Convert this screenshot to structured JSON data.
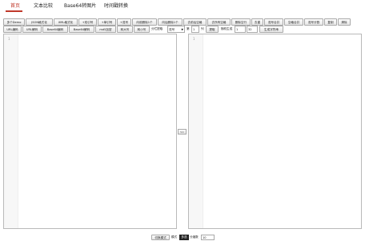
{
  "nav": {
    "tabs": [
      {
        "label": "首页",
        "active": true
      },
      {
        "label": "文本比较",
        "active": false
      },
      {
        "label": "Base64转图片",
        "active": false
      },
      {
        "label": "时间戳转换",
        "active": false
      }
    ]
  },
  "toolbar_row1": [
    "多个Demo",
    "JSON格式化",
    "XML格式化",
    "+双引号",
    "+单引号",
    "+逗号",
    "向前删除1个",
    "向后删除1个",
    "去前后空格",
    "去所有空格",
    "删除空行",
    "去重",
    "逗号合并",
    "空格合并",
    "逗号分割",
    "复制",
    "清除"
  ],
  "toolbar_row2": {
    "buttons": [
      "URL编码",
      "URL解码",
      "Base64编码",
      "Base64解码",
      "md5加密",
      "转大写",
      "转小写"
    ],
    "split_label": "分栏提取",
    "split_select": "逗号",
    "column_label": "第",
    "column_value": "1",
    "column_unit": "列",
    "extract_button": "提取",
    "random_label": "随机生成",
    "random_value_1": "1",
    "random_value_2": "32",
    "generate_button": "生成字符串"
  },
  "editors": {
    "left_line": "1",
    "right_line": "1"
  },
  "swap_label": "<=",
  "footer": {
    "mode_button": "切换模式",
    "mode_label": "模式",
    "mode_value": "多选",
    "tab_label": "分缩数",
    "tab_value": "10"
  }
}
